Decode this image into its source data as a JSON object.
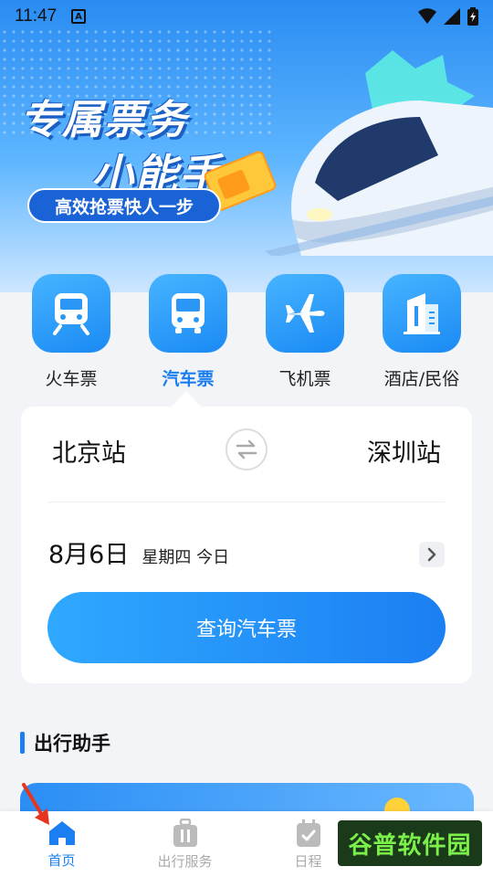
{
  "status_bar": {
    "time": "11:47",
    "notification_icon": "A"
  },
  "banner": {
    "title_line1": "专属票务",
    "title_line2": "小能手",
    "slogan": "高效抢票快人一步"
  },
  "categories": [
    {
      "label": "火车票",
      "icon": "train-icon",
      "active": false
    },
    {
      "label": "汽车票",
      "icon": "bus-icon",
      "active": true
    },
    {
      "label": "飞机票",
      "icon": "plane-icon",
      "active": false
    },
    {
      "label": "酒店/民俗",
      "icon": "hotel-icon",
      "active": false
    }
  ],
  "search": {
    "from_station": "北京站",
    "to_station": "深圳站",
    "date": "8月6日",
    "weekday": "星期四 今日",
    "button_label": "查询汽车票"
  },
  "assistant": {
    "title": "出行助手"
  },
  "bottom_nav": [
    {
      "label": "首页",
      "icon": "home-icon",
      "active": true
    },
    {
      "label": "出行服务",
      "icon": "luggage-icon",
      "active": false
    },
    {
      "label": "日程",
      "icon": "calendar-icon",
      "active": false
    },
    {
      "label": "",
      "icon": "profile-icon",
      "active": false
    }
  ],
  "watermark": "谷普软件园",
  "colors": {
    "accent": "#1b7ff2",
    "banner_top": "#2a8cf2",
    "button": "#2fa8ff"
  }
}
